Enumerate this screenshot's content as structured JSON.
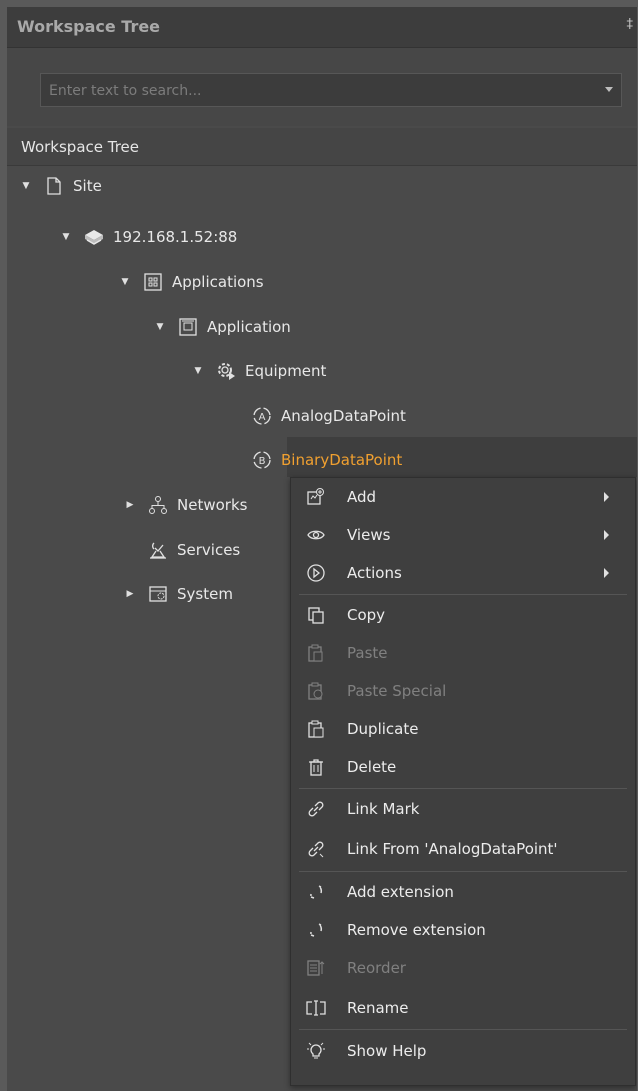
{
  "panel": {
    "title": "Workspace Tree",
    "pin_glyph": "‡"
  },
  "search": {
    "placeholder": "Enter text to search..."
  },
  "tree": {
    "header": "Workspace Tree",
    "nodes": [
      {
        "label": "Site",
        "icon": "page-icon"
      },
      {
        "label": "192.168.1.52:88",
        "icon": "server-icon"
      },
      {
        "label": "Applications",
        "icon": "applications-icon"
      },
      {
        "label": "Application",
        "icon": "application-icon"
      },
      {
        "label": "Equipment",
        "icon": "equipment-gear-icon"
      },
      {
        "label": "AnalogDataPoint",
        "icon": "analog-datapoint-icon"
      },
      {
        "label": "BinaryDataPoint",
        "icon": "binary-datapoint-icon"
      },
      {
        "label": "Networks",
        "icon": "networks-icon"
      },
      {
        "label": "Services",
        "icon": "services-icon"
      },
      {
        "label": "System",
        "icon": "system-icon"
      }
    ]
  },
  "context_menu": {
    "items": [
      {
        "label": "Add",
        "icon": "add-icon",
        "submenu": true,
        "enabled": true
      },
      {
        "label": "Views",
        "icon": "eye-icon",
        "submenu": true,
        "enabled": true
      },
      {
        "label": "Actions",
        "icon": "play-circle-icon",
        "submenu": true,
        "enabled": true
      },
      {
        "label": "Copy",
        "icon": "copy-icon",
        "enabled": true
      },
      {
        "label": "Paste",
        "icon": "paste-icon",
        "enabled": false
      },
      {
        "label": "Paste Special",
        "icon": "paste-special-icon",
        "enabled": false
      },
      {
        "label": "Duplicate",
        "icon": "duplicate-icon",
        "enabled": true
      },
      {
        "label": "Delete",
        "icon": "trash-icon",
        "enabled": true
      },
      {
        "label": "Link Mark",
        "icon": "link-icon",
        "enabled": true
      },
      {
        "label": "Link From 'AnalogDataPoint'",
        "icon": "link-from-icon",
        "enabled": true
      },
      {
        "label": "Add extension",
        "icon": "add-extension-icon",
        "enabled": true
      },
      {
        "label": "Remove extension",
        "icon": "remove-extension-icon",
        "enabled": true
      },
      {
        "label": "Reorder",
        "icon": "reorder-icon",
        "enabled": false
      },
      {
        "label": "Rename",
        "icon": "rename-icon",
        "enabled": true
      },
      {
        "label": "Show Help",
        "icon": "lightbulb-icon",
        "enabled": true
      }
    ]
  },
  "colors": {
    "selected_text": "#f0a030",
    "background": "#4a4a4a",
    "menu_background": "#3f3f3f"
  }
}
